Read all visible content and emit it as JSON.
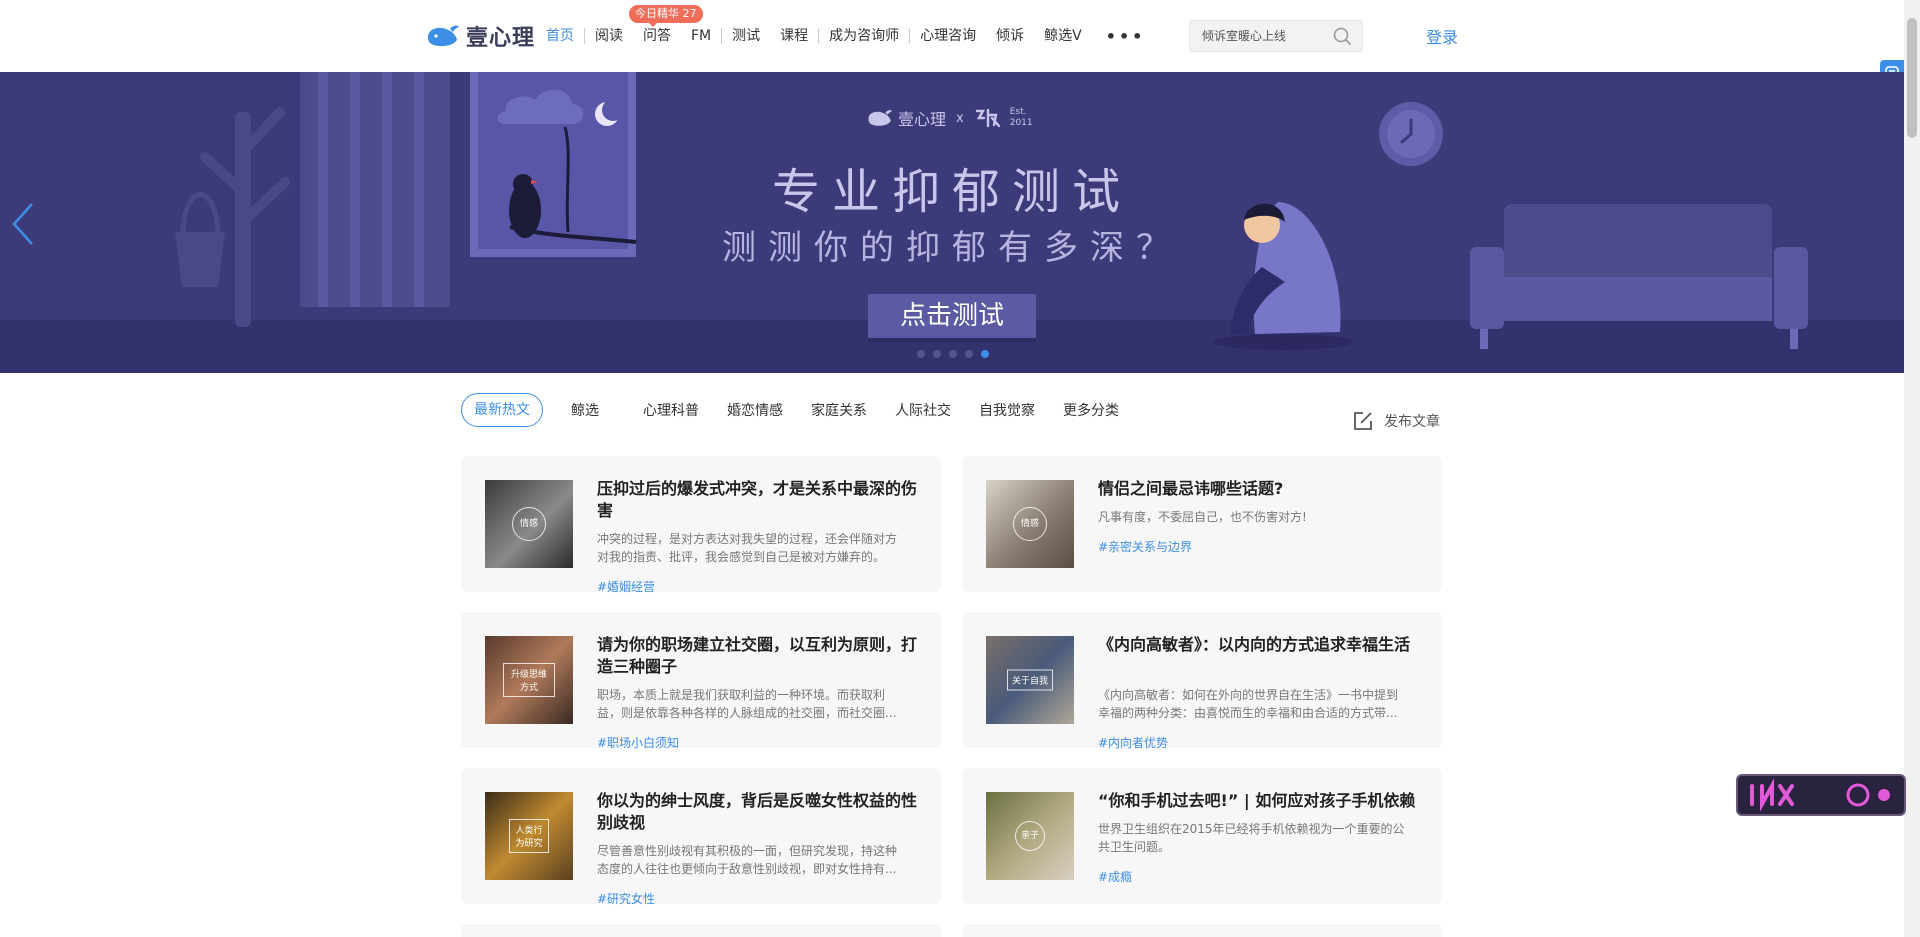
{
  "header": {
    "logo_text": "壹心理",
    "nav": [
      {
        "label": "首页",
        "active": true
      },
      {
        "label": "阅读"
      },
      {
        "label": "问答"
      },
      {
        "label": "FM"
      },
      {
        "label": "测试"
      },
      {
        "label": "课程"
      },
      {
        "label": "成为咨询师"
      },
      {
        "label": "心理咨询"
      },
      {
        "label": "倾诉"
      },
      {
        "label": "鲸选V"
      }
    ],
    "badge": "今日精华 27",
    "more": "•••",
    "search_placeholder": "倾诉室暖心上线",
    "login": "登录"
  },
  "banner": {
    "brand_logo": "壹心理",
    "brand_x": "x",
    "est_line1": "Est.",
    "est_line2": "2011",
    "title": "专业抑郁测试",
    "subtitle": "测测你的抑郁有多深？",
    "cta": "点击测试",
    "slides": 5,
    "active_slide": 5
  },
  "categories": [
    "最新热文",
    "鲸选",
    "心理科普",
    "婚恋情感",
    "家庭关系",
    "人际社交",
    "自我觉察",
    "更多分类"
  ],
  "publish_label": "发布文章",
  "articles": [
    {
      "title": "压抑过后的爆发式冲突，才是关系中最深的伤害",
      "desc": "冲突的过程，是对方表达对我失望的过程，还会伴随对方对我的指责、批评，我会感觉到自己是被对方嫌弃的。",
      "tag": "#婚姻经营",
      "thumb_label": "情感"
    },
    {
      "title": "情侣之间最忌讳哪些话题?",
      "desc": "凡事有度，不委屈自己，也不伤害对方!",
      "tag": "#亲密关系与边界",
      "thumb_label": "情感"
    },
    {
      "title": "请为你的职场建立社交圈，以互利为原则，打造三种圈子",
      "desc": "职场，本质上就是我们获取利益的一种环境。而获取利益，则是依靠各种各样的人脉组成的社交圈，而社交圈...",
      "tag": "#职场小白须知",
      "thumb_label": "升级思维方式"
    },
    {
      "title": "《内向高敏者》：以内向的方式追求幸福生活",
      "desc": "《内向高敏者：如何在外向的世界自在生活》一书中提到幸福的两种分类：由喜悦而生的幸福和由合适的方式带...",
      "tag": "#内向者优势",
      "thumb_label": "关于自我"
    },
    {
      "title": "你以为的绅士风度，背后是反噬女性权益的性别歧视",
      "desc": "尽管善意性别歧视有其积极的一面，但研究发现，持这种态度的人往往也更倾向于敌意性别歧视，即对女性持有...",
      "tag": "#研究女性",
      "thumb_label": "人类行为研究"
    },
    {
      "title": "“你和手机过去吧!” | 如何应对孩子手机依赖",
      "desc": "世界卫生组织在2015年已经将手机依赖视为一个重要的公共卫生问题。",
      "tag": "#成瘾",
      "thumb_label": "亲子"
    }
  ],
  "colors": {
    "accent": "#3d8ee6",
    "banner_bg": "#3c3a78",
    "badge": "#f06d5a",
    "card_bg": "#f7f7f8"
  }
}
